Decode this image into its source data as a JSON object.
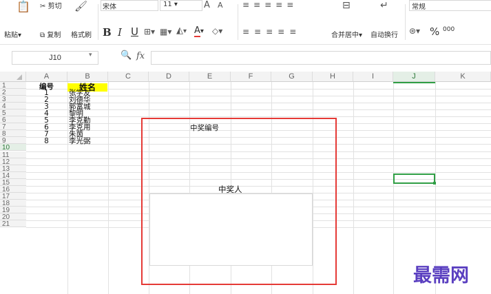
{
  "ribbon": {
    "cut": "剪切",
    "paste": "粘贴",
    "copy": "复制",
    "format_painter": "格式刷",
    "font_name": "宋体",
    "font_size": "11",
    "merge_center": "合并居中",
    "wrap_text": "自动换行",
    "number_format": "常规",
    "percent": "%",
    "thousands": "000"
  },
  "formula_bar": {
    "name_box": "J10",
    "fx": "fx",
    "formula": ""
  },
  "columns": [
    "A",
    "B",
    "C",
    "D",
    "E",
    "F",
    "G",
    "H",
    "I",
    "J",
    "K"
  ],
  "rows": [
    "1",
    "2",
    "3",
    "4",
    "5",
    "6",
    "7",
    "8",
    "9",
    "10",
    "11",
    "12",
    "13",
    "14",
    "15",
    "16",
    "17",
    "18",
    "19",
    "20",
    "21"
  ],
  "sheet": {
    "header_a": "编号",
    "header_b": "姓名",
    "records": [
      {
        "id": "1",
        "name": "张学友"
      },
      {
        "id": "2",
        "name": "刘德华"
      },
      {
        "id": "3",
        "name": "郭富城"
      },
      {
        "id": "4",
        "name": "黎明"
      },
      {
        "id": "5",
        "name": "李克勤"
      },
      {
        "id": "6",
        "name": "李克用"
      },
      {
        "id": "7",
        "name": "朱茵"
      },
      {
        "id": "8",
        "name": "李光弼"
      }
    ],
    "prize_number_label": "中奖编号",
    "winner_label": "中奖人"
  },
  "watermark": "最需网",
  "colors": {
    "highlight_yellow": "#ffff00",
    "selection_green": "#2f9e44",
    "frame_red": "#e53935",
    "watermark_purple": "#5a3fc0"
  }
}
